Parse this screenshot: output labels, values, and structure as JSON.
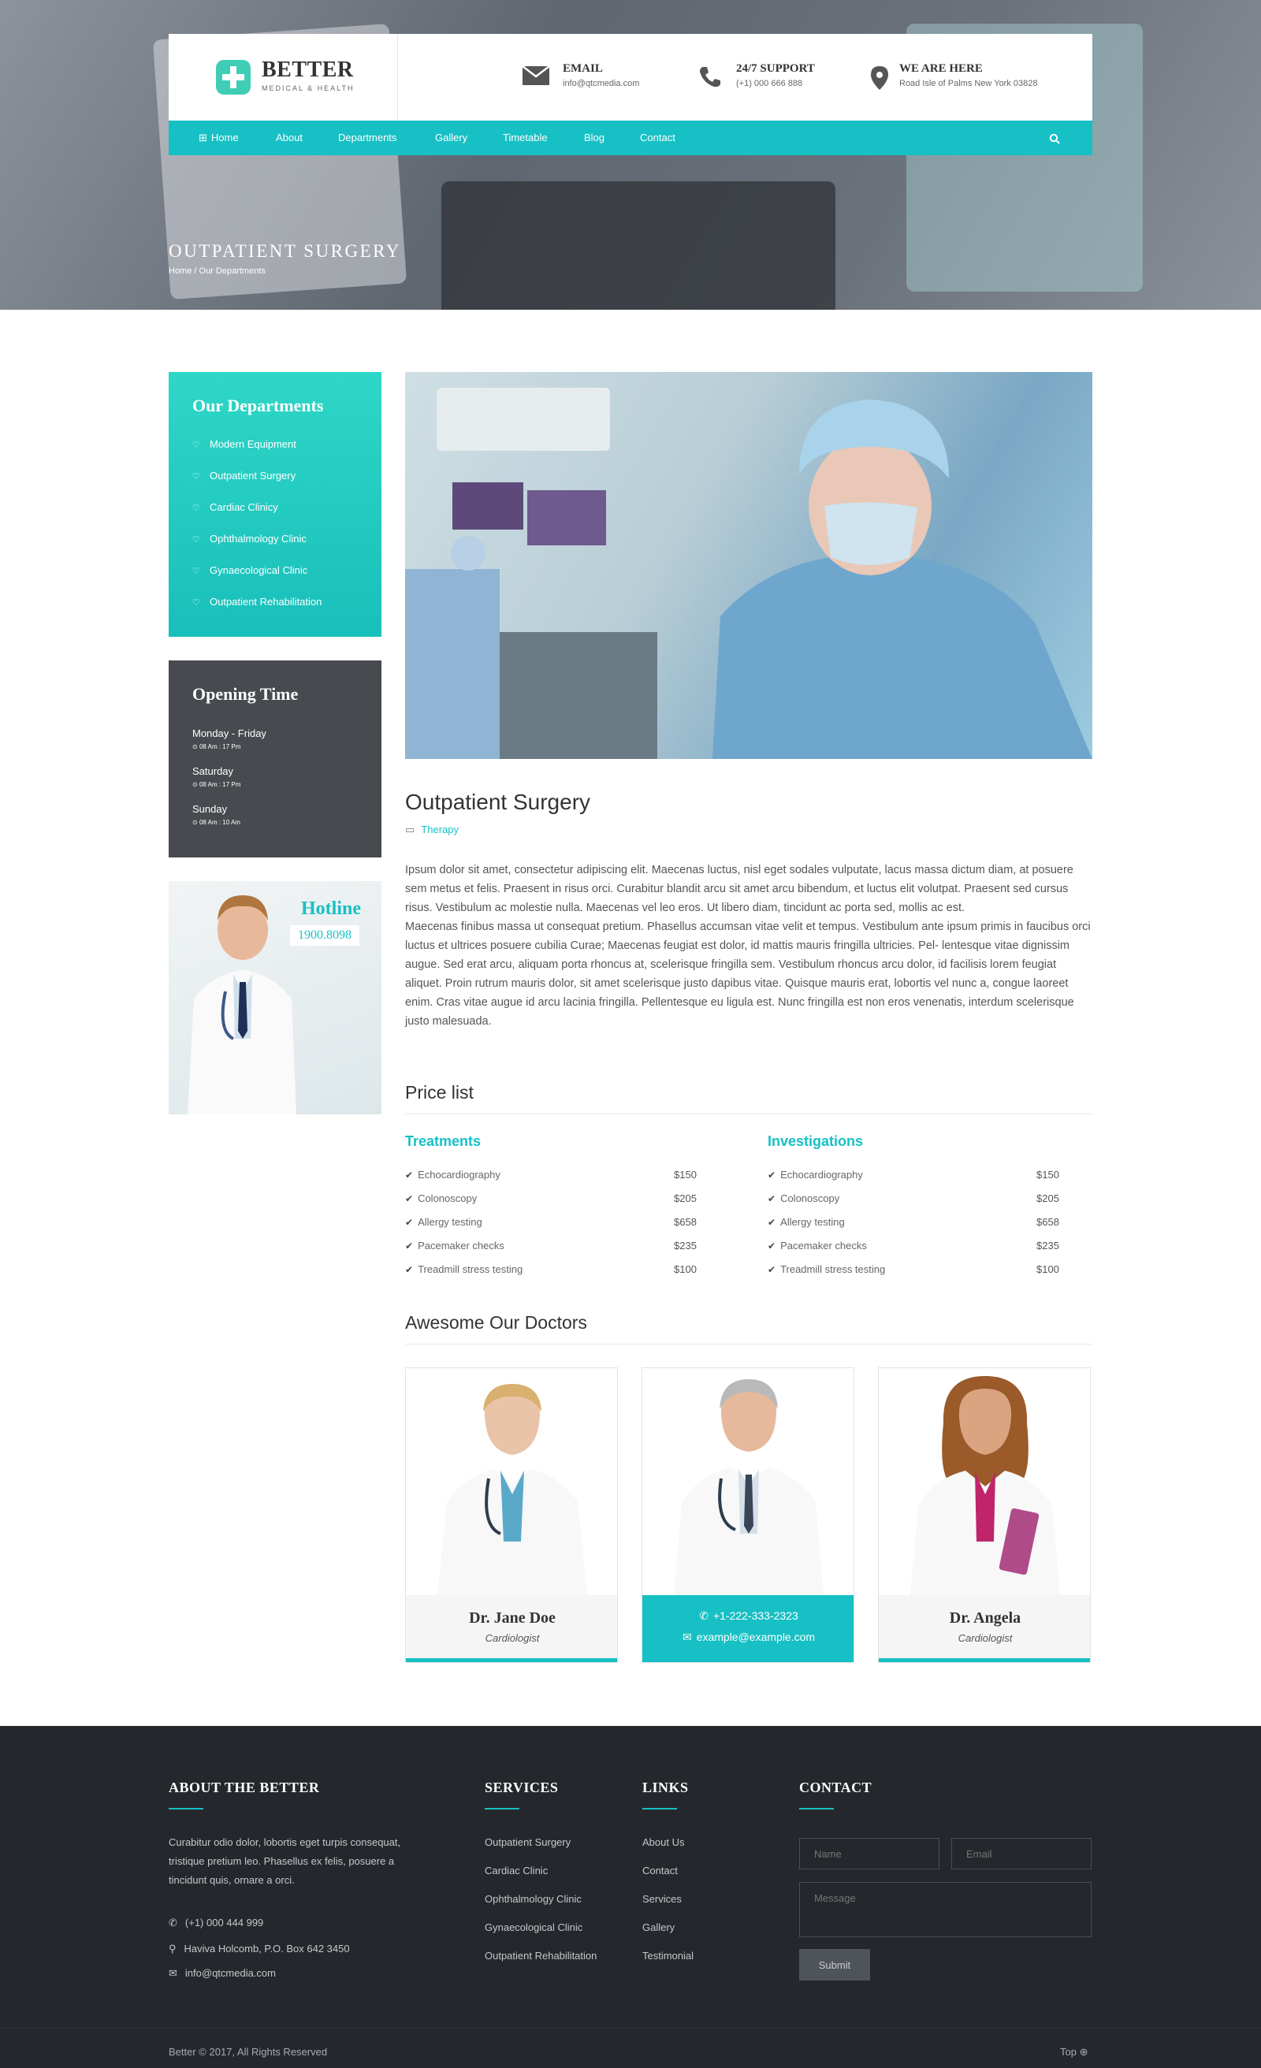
{
  "header": {
    "logo_name": "BETTER",
    "logo_tagline": "MEDICAL & HEALTH",
    "email_title": "EMAIL",
    "email_value": "info@qtcmedia.com",
    "support_title": "24/7 SUPPORT",
    "support_value": "(+1) 000 666 888",
    "location_title": "WE ARE HERE",
    "location_value": "Road Isle of Palms New York 03828"
  },
  "nav": {
    "items": [
      "Home",
      "About",
      "Departments",
      "Gallery",
      "Timetable",
      "Blog",
      "Contact"
    ],
    "active_icon": "⊞"
  },
  "hero": {
    "title": "OUTPATIENT SURGERY",
    "breadcrumb": "Home / Our Departments"
  },
  "sidebar": {
    "departments_title": "Our Departments",
    "departments": [
      "Modern Equipment",
      "Outpatient Surgery",
      "Cardiac Clinicy",
      "Ophthalmology Clinic",
      "Gynaecological Clinic",
      "Outpatient Rehabilitation"
    ],
    "opening_title": "Opening Time",
    "opening": [
      {
        "day": "Monday - Friday",
        "time": "08 Am : 17 Pm"
      },
      {
        "day": "Saturday",
        "time": "08 Am : 17 Pm"
      },
      {
        "day": "Sunday",
        "time": "08 Am : 10 Am"
      }
    ],
    "hotline_title": "Hotline",
    "hotline_number": "1900.8098"
  },
  "post": {
    "title": "Outpatient Surgery",
    "category": "Therapy",
    "body": "Ipsum dolor sit amet, consectetur adipiscing elit. Maecenas luctus, nisl eget sodales vulputate, lacus massa dictum diam, at posuere sem metus et felis. Praesent in risus orci. Curabitur blandit arcu sit amet arcu bibendum, et luctus elit volutpat. Praesent sed cursus risus. Vestibulum ac molestie nulla. Maecenas vel leo eros. Ut libero diam, tincidunt ac porta sed, mollis ac est.",
    "body2": "Maecenas finibus massa ut consequat pretium. Phasellus accumsan vitae velit et tempus. Vestibulum ante ipsum primis in faucibus orci luctus et ultrices posuere cubilia Curae; Maecenas feugiat est dolor, id mattis mauris fringilla ultricies. Pel- lentesque vitae dignissim augue. Sed erat arcu, aliquam porta rhoncus at, scelerisque fringilla sem. Vestibulum rhoncus arcu dolor, id facilisis lorem feugiat aliquet. Proin rutrum mauris dolor, sit amet scelerisque justo dapibus vitae. Quisque mauris erat, lobortis vel nunc a, congue laoreet enim. Cras vitae augue id arcu lacinia fringilla. Pellentesque eu ligula est. Nunc fringilla est non eros venenatis, interdum scelerisque justo malesuada."
  },
  "price_list": {
    "title": "Price list",
    "treatments_title": "Treatments",
    "investigations_title": "Investigations",
    "treatments": [
      {
        "name": "Echocardiography",
        "price": "$150"
      },
      {
        "name": "Colonoscopy",
        "price": "$205"
      },
      {
        "name": "Allergy testing",
        "price": "$658"
      },
      {
        "name": "Pacemaker checks",
        "price": "$235"
      },
      {
        "name": "Treadmill stress testing",
        "price": "$100"
      }
    ],
    "investigations": [
      {
        "name": "Echocardiography",
        "price": "$150"
      },
      {
        "name": "Colonoscopy",
        "price": "$205"
      },
      {
        "name": "Allergy testing",
        "price": "$658"
      },
      {
        "name": "Pacemaker checks",
        "price": "$235"
      },
      {
        "name": "Treadmill stress testing",
        "price": "$100"
      }
    ]
  },
  "doctors": {
    "title": "Awesome Our Doctors",
    "list": [
      {
        "name": "Dr. Jane Doe",
        "role": "Cardiologist"
      },
      {
        "phone": "+1-222-333-2323",
        "email": "example@example.com"
      },
      {
        "name": "Dr. Angela",
        "role": "Cardiologist"
      }
    ]
  },
  "footer": {
    "about_title": "ABOUT THE BETTER",
    "about_text": "Curabitur odio dolor, lobortis eget turpis consequat, tristique pretium leo. Phasellus ex felis, posuere a tincidunt quis, ornare a orci.",
    "phone": "(+1) 000 444 999",
    "address": "Haviva Holcomb, P.O. Box 642 3450",
    "email": "info@qtcmedia.com",
    "services_title": "SERVICES",
    "services": [
      "Outpatient Surgery",
      "Cardiac Clinic",
      "Ophthalmology Clinic",
      "Gynaecological Clinic",
      "Outpatient Rehabilitation"
    ],
    "links_title": "LINKS",
    "links": [
      "About Us",
      "Contact",
      "Services",
      "Gallery",
      "Testimonial"
    ],
    "contact_title": "CONTACT",
    "name_placeholder": "Name",
    "email_placeholder": "Email",
    "message_placeholder": "Message",
    "submit_label": "Submit",
    "copyright": "Better © 2017, All Rights Reserved",
    "top_label": "Top ⊕"
  },
  "colors": {
    "accent": "#17c0c4",
    "dark": "#24282c",
    "panel": "#474a4f"
  }
}
